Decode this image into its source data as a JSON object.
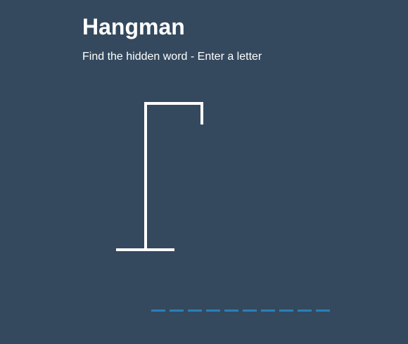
{
  "header": {
    "title": "Hangman",
    "subtitle": "Find the hidden word - Enter a letter"
  },
  "game": {
    "wrong_guesses": 0,
    "word_length": 10,
    "letters": [
      "",
      "",
      "",
      "",
      "",
      "",
      "",
      "",
      "",
      ""
    ]
  },
  "colors": {
    "background": "#34495e",
    "text": "#ffffff",
    "gallows": "#ffffff",
    "letter_slot": "#2980b9"
  }
}
